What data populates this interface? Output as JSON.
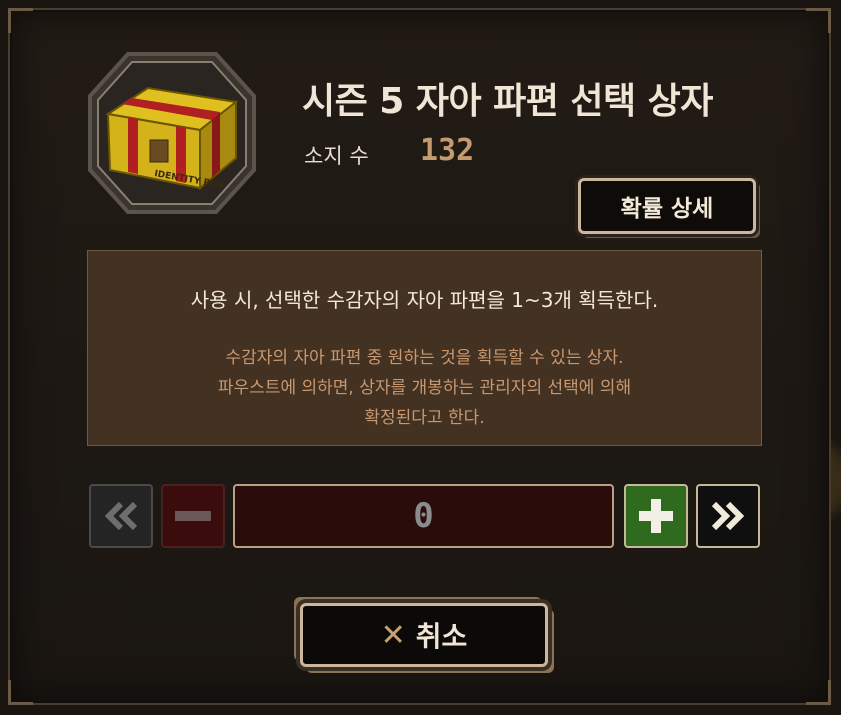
{
  "dialog": {
    "title": "시즌 5 자아 파편 선택 상자",
    "owned_label": "소지 수",
    "owned_count": "132",
    "probability_button": "확률 상세",
    "description_main": "사용 시, 선택한 수감자의 자아 파편을 1~3개 획득한다.",
    "description_flavor": [
      "수감자의 자아 파편 중 원하는 것을 획득할 수 있는 상자.",
      "파우스트에 의하면, 상자를 개봉하는 관리자의 선택에 의해",
      "확정된다고 한다."
    ],
    "quantity": "0",
    "cancel_label": "취소",
    "box_label": "IDENTITY BOX"
  },
  "icons": {
    "box": "identity-box-icon",
    "min": "double-chevron-left-icon",
    "dec": "minus-icon",
    "inc": "plus-icon",
    "max": "double-chevron-right-icon",
    "cancel": "close-icon"
  },
  "colors": {
    "accent_gold": "#cdb79a",
    "count_color": "#c49a6f",
    "flavor_text": "#c89870",
    "plus_green": "#3a6e25",
    "minus_red": "#5a1414"
  }
}
